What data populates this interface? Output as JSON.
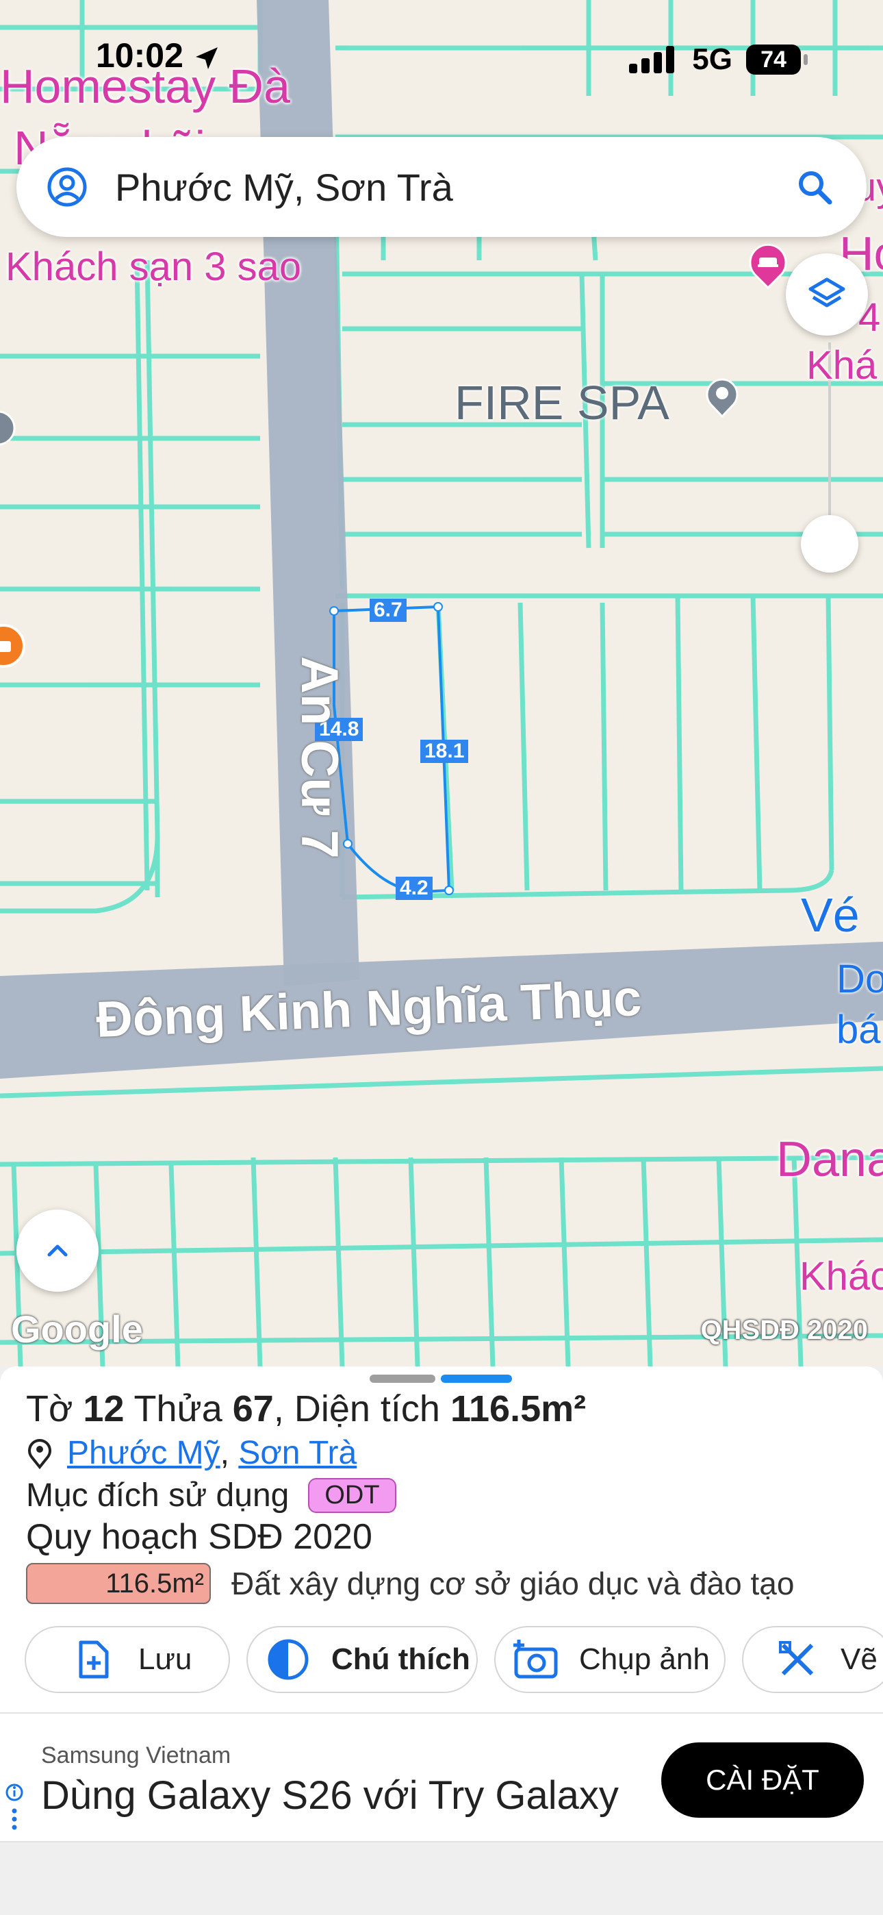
{
  "status_bar": {
    "time": "10:02",
    "network": "5G",
    "battery": "74"
  },
  "search": {
    "text": "Phước Mỹ, Sơn Trà"
  },
  "map": {
    "road_labels": [
      "An Cư 7",
      "Đông Kinh Nghĩa Thục"
    ],
    "poi_labels": [
      "Homestay Đà",
      "Nẵng bãi",
      "Khách sạn 3 sao",
      "FIRE SPA",
      "Vé",
      "Do",
      "bá",
      "Dana",
      "Khác",
      "Hot",
      "Khá",
      "uy",
      "4"
    ],
    "parcel_edges": [
      "6.7",
      "14.8",
      "18.1",
      "4.2"
    ],
    "attribution": "Google",
    "layer_name": "QHSDĐ 2020"
  },
  "parcel": {
    "sheet_label": "Tờ",
    "sheet_no": "12",
    "plot_label": "Thửa",
    "plot_no": "67",
    "area_label": ", Diện tích",
    "area": "116.5m²",
    "ward": "Phước Mỹ",
    "district": "Sơn Trà",
    "purpose_label": "Mục đích sử dụng",
    "purpose_code": "ODT",
    "plan_title": "Quy hoạch SDĐ 2020",
    "plan_area": "116.5m²",
    "plan_desc": "Đất xây dựng cơ sở giáo dục và đào tạo"
  },
  "actions": [
    "Lưu",
    "Chú thích",
    "Chụp ảnh",
    "Vẽ"
  ],
  "ad": {
    "advertiser": "Samsung Vietnam",
    "title": "Dùng Galaxy S26 với Try Galaxy",
    "cta": "CÀI ĐẶT"
  },
  "colors": {
    "accent": "#1a73e8",
    "poi": "#d63aa8",
    "parcel_lines": "#5fe0c8",
    "road": "#a7b3c4",
    "plan_fill": "#f4a59a",
    "odt_badge": "#f29bf0"
  }
}
